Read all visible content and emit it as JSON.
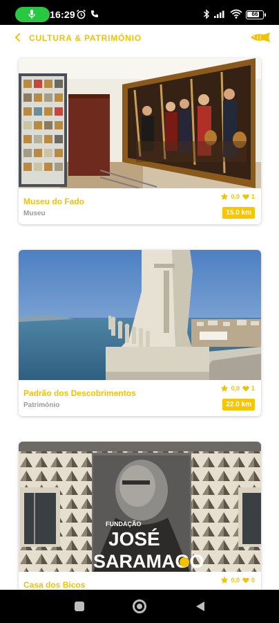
{
  "status_bar": {
    "time": "16:29",
    "battery": "66",
    "icons": [
      "mic-icon",
      "alarm-icon",
      "call-icon",
      "bluetooth-icon",
      "signal-icon",
      "wifi-icon",
      "battery-icon"
    ]
  },
  "header": {
    "title": "CULTURA & PATRIMÓNIO",
    "back_icon": "chevron-left-icon",
    "logo_icon": "fish-logo-icon"
  },
  "places": [
    {
      "name": "Museu do Fado",
      "category": "Museu",
      "rating": "0,0",
      "likes": "1",
      "distance": "15.0 km"
    },
    {
      "name": "Padrão dos Descobrimentos",
      "category": "Património",
      "rating": "0,0",
      "likes": "1",
      "distance": "22.0 km"
    },
    {
      "name": "Casa dos Bicos",
      "category": "",
      "rating": "0,0",
      "likes": "0",
      "distance": ""
    }
  ],
  "poster": {
    "line1": "FUNDAÇÃO",
    "line2": "JOSÉ",
    "line3": "SARAMAGO"
  },
  "colors": {
    "accent": "#f2c200",
    "badge": "#f7c600",
    "status_bar": "#000000",
    "mic_pill": "#28c840"
  },
  "nav_bar": {
    "icons": [
      "recent-apps-icon",
      "home-icon",
      "back-icon"
    ]
  }
}
